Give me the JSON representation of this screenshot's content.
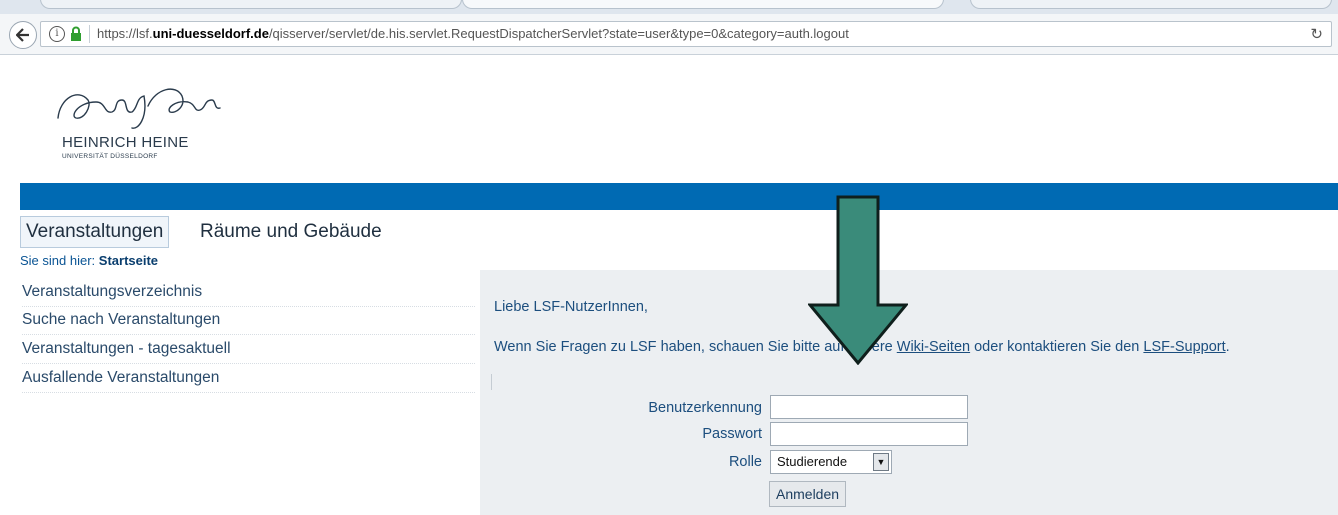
{
  "browser": {
    "url_prefix": "https://lsf.",
    "url_domain": "uni-duesseldorf.de",
    "url_rest": "/qisserver/servlet/de.his.servlet.RequestDispatcherServlet?state=user&type=0&category=auth.logout",
    "info_icon": "info-icon",
    "lock_icon": "lock-icon",
    "reload_icon": "reload-icon",
    "back_icon": "back-arrow-icon"
  },
  "logo": {
    "name": "HEINRICH HEINE",
    "sub": "UNIVERSITÄT DÜSSELDORF"
  },
  "colors": {
    "brand_blue": "#006ab3",
    "panel_bg": "#eceff2",
    "arrow_fill": "#3a8b7a",
    "link_text": "#1c4e7e"
  },
  "nav": {
    "tabs": [
      {
        "label": "Veranstaltungen",
        "active": true
      },
      {
        "label": "Räume und Gebäude",
        "active": false
      }
    ],
    "breadcrumb_prefix": "Sie sind hier:",
    "breadcrumb_current": "Startseite"
  },
  "sidebar": {
    "items": [
      {
        "label": "Veranstaltungsverzeichnis"
      },
      {
        "label": "Suche nach Veranstaltungen"
      },
      {
        "label": "Veranstaltungen - tagesaktuell"
      },
      {
        "label": "Ausfallende Veranstaltungen"
      }
    ]
  },
  "content": {
    "greeting": "Liebe LSF-NutzerInnen,",
    "info_before": "Wenn Sie Fragen zu LSF haben, schauen Sie bitte auf unsere ",
    "wiki_link": "Wiki-Seiten",
    "info_middle": " oder kontaktieren Sie den ",
    "support_link": "LSF-Support",
    "info_after": "."
  },
  "login": {
    "username_label": "Benutzerkennung",
    "username_value": "",
    "password_label": "Passwort",
    "password_value": "",
    "role_label": "Rolle",
    "role_value": "Studierende",
    "submit_label": "Anmelden"
  }
}
